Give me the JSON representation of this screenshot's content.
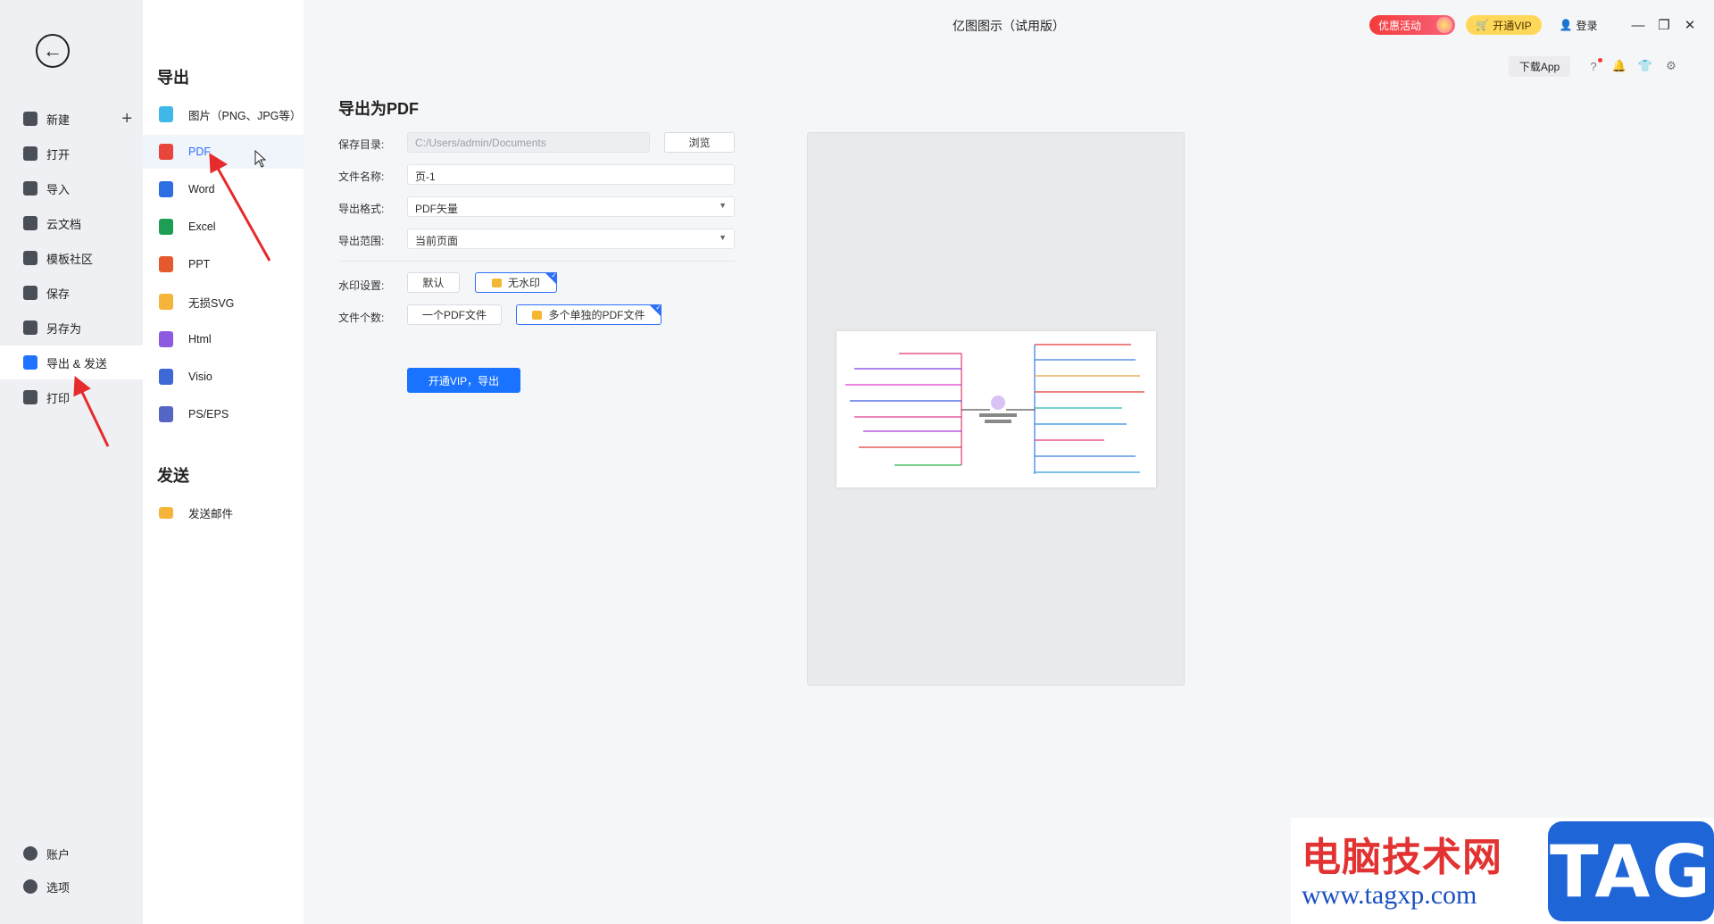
{
  "app": {
    "title": "亿图图示（试用版）"
  },
  "topbar": {
    "promo_label": "优惠活动",
    "vip_label": "开通VIP",
    "login_label": "登录",
    "download_app_label": "下载App"
  },
  "left_nav": {
    "items": [
      {
        "label": "新建",
        "icon": "plus-square-icon"
      },
      {
        "label": "打开",
        "icon": "folder-icon"
      },
      {
        "label": "导入",
        "icon": "import-icon"
      },
      {
        "label": "云文档",
        "icon": "cloud-icon"
      },
      {
        "label": "模板社区",
        "icon": "community-icon"
      },
      {
        "label": "保存",
        "icon": "save-icon"
      },
      {
        "label": "另存为",
        "icon": "save-as-icon"
      },
      {
        "label": "导出 & 发送",
        "icon": "export-icon",
        "active": true
      },
      {
        "label": "打印",
        "icon": "print-icon"
      }
    ],
    "bottom": [
      {
        "label": "账户",
        "icon": "account-icon"
      },
      {
        "label": "选项",
        "icon": "gear-icon"
      }
    ]
  },
  "export_col": {
    "export_title": "导出",
    "types": [
      {
        "label": "图片（PNG、JPG等）",
        "color": "#3fb7e8"
      },
      {
        "label": "PDF",
        "color": "#e8453c",
        "active": true
      },
      {
        "label": "Word",
        "color": "#2d6ee3"
      },
      {
        "label": "Excel",
        "color": "#1e9e55"
      },
      {
        "label": "PPT",
        "color": "#e45a2e"
      },
      {
        "label": "无损SVG",
        "color": "#f4b53a"
      },
      {
        "label": "Html",
        "color": "#8e5adf"
      },
      {
        "label": "Visio",
        "color": "#3c68d8"
      },
      {
        "label": "PS/EPS",
        "color": "#5566c6"
      }
    ],
    "send_title": "发送",
    "send_items": [
      {
        "label": "发送邮件",
        "color": "#f4b53a"
      }
    ]
  },
  "form": {
    "title": "导出为PDF",
    "dir_label": "保存目录:",
    "dir_value": "C:/Users/admin/Documents",
    "browse_label": "浏览",
    "name_label": "文件名称:",
    "name_value": "页-1",
    "format_label": "导出格式:",
    "format_value": "PDF矢量",
    "range_label": "导出范围:",
    "range_value": "当前页面",
    "watermark_label": "水印设置:",
    "watermark_default": "默认",
    "watermark_none": "无水印",
    "count_label": "文件个数:",
    "count_one": "一个PDF文件",
    "count_multi": "多个单独的PDF文件",
    "export_btn": "开通VIP，导出"
  },
  "watermark": {
    "line1": "电脑技术网",
    "line2": "www.tagxp.com",
    "tag": "TAG"
  }
}
